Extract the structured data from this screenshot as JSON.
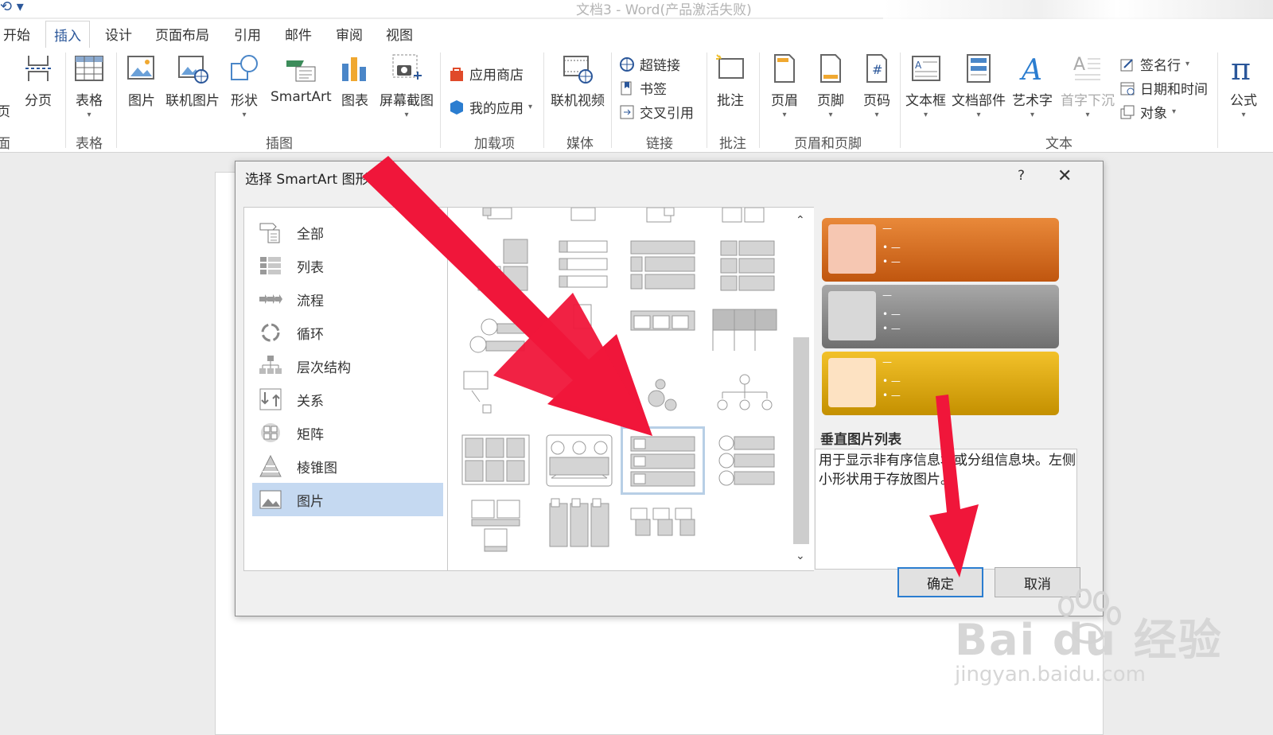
{
  "window": {
    "title": "文档3 - Word(产品激活失败)"
  },
  "tabs": [
    "开始",
    "插入",
    "设计",
    "页面布局",
    "引用",
    "邮件",
    "审阅",
    "视图"
  ],
  "active_tab": "插入",
  "ribbon": {
    "page_label": "页",
    "fen_ye": "分页",
    "table": "表格",
    "picture": "图片",
    "online_picture": "联机图片",
    "shapes": "形状",
    "smartart": "SmartArt",
    "chart": "图表",
    "screenshot": "屏幕截图",
    "app_store": "应用商店",
    "my_apps": "我的应用",
    "online_video": "联机视频",
    "hyperlink": "超链接",
    "bookmark": "书签",
    "cross_ref": "交叉引用",
    "comment": "批注",
    "header": "页眉",
    "footer": "页脚",
    "page_number": "页码",
    "text_box": "文本框",
    "quick_parts": "文档部件",
    "wordart": "艺术字",
    "drop_cap": "首字下沉",
    "signature": "签名行",
    "datetime": "日期和时间",
    "object": "对象",
    "equation": "公式",
    "groups": {
      "pages": "面",
      "tables": "表格",
      "illustrations": "插图",
      "addins": "加载项",
      "media": "媒体",
      "links": "链接",
      "comments": "批注",
      "header_footer": "页眉和页脚",
      "text": "文本"
    }
  },
  "dialog": {
    "title": "选择 SmartArt 图形",
    "help": "?",
    "categories": [
      "全部",
      "列表",
      "流程",
      "循环",
      "层次结构",
      "关系",
      "矩阵",
      "棱锥图",
      "图片"
    ],
    "selected_category": "图片",
    "selected_layout_name": "垂直图片列表",
    "selected_layout_desc": "用于显示非有序信息块或分组信息块。左侧小形状用于存放图片。",
    "ok": "确定",
    "cancel": "取消",
    "preview_colors": [
      "#d4661c",
      "#8c8c8c",
      "#d9a21a"
    ]
  },
  "watermark": {
    "brand": "Bai du 经验",
    "url": "jingyan.baidu.com"
  }
}
